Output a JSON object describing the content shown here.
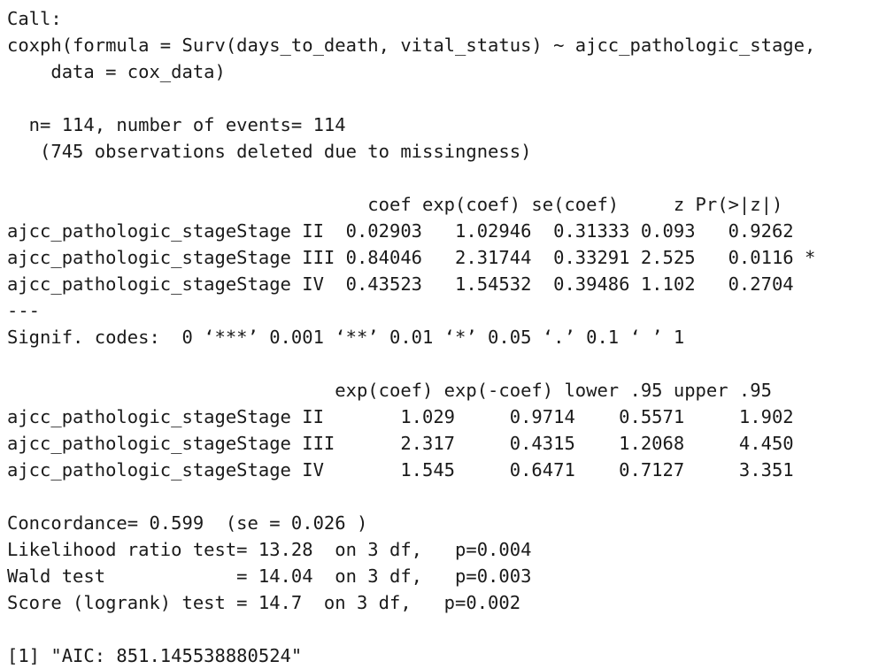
{
  "console": {
    "lines": [
      "Call:",
      "coxph(formula = Surv(days_to_death, vital_status) ~ ajcc_pathologic_stage,",
      "    data = cox_data)",
      "",
      "  n= 114, number of events= 114",
      "   (745 observations deleted due to missingness)",
      "",
      "                                 coef exp(coef) se(coef)     z Pr(>|z|)",
      "ajcc_pathologic_stageStage II  0.02903   1.02946  0.31333 0.093   0.9262",
      "ajcc_pathologic_stageStage III 0.84046   2.31744  0.33291 2.525   0.0116 *",
      "ajcc_pathologic_stageStage IV  0.43523   1.54532  0.39486 1.102   0.2704",
      "---",
      "Signif. codes:  0 ‘***’ 0.001 ‘**’ 0.01 ‘*’ 0.05 ‘.’ 0.1 ‘ ’ 1",
      "",
      "                              exp(coef) exp(-coef) lower .95 upper .95",
      "ajcc_pathologic_stageStage II       1.029     0.9714    0.5571     1.902",
      "ajcc_pathologic_stageStage III      2.317     0.4315    1.2068     4.450",
      "ajcc_pathologic_stageStage IV       1.545     0.6471    0.7127     3.351",
      "",
      "Concordance= 0.599  (se = 0.026 )",
      "Likelihood ratio test= 13.28  on 3 df,   p=0.004",
      "Wald test            = 14.04  on 3 df,   p=0.003",
      "Score (logrank) test = 14.7  on 3 df,   p=0.002",
      "",
      "[1] \"AIC: 851.145538880524\""
    ]
  }
}
